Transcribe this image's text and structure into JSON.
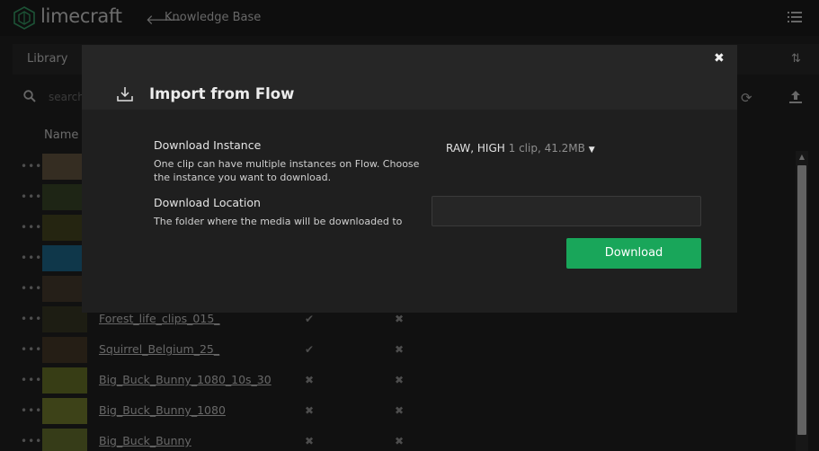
{
  "app": {
    "logo_text": "limecraft",
    "nav_label": "Knowledge Base"
  },
  "library": {
    "title": "Library",
    "search_placeholder": "search",
    "name_column": "Name"
  },
  "rows": [
    {
      "title": "",
      "c1": "",
      "c2": "",
      "thumb": "#6a5a44"
    },
    {
      "title": "",
      "c1": "",
      "c2": "",
      "thumb": "#3d4a2a"
    },
    {
      "title": "",
      "c1": "",
      "c2": "",
      "thumb": "#4a4a22"
    },
    {
      "title": "",
      "c1": "",
      "c2": "",
      "thumb": "#1f6e94"
    },
    {
      "title": "",
      "c1": "",
      "c2": "",
      "thumb": "#4b3e30"
    },
    {
      "title": "Forest_life_clips_015_",
      "c1": "✔",
      "c2": "✖",
      "thumb": "#3a3a26"
    },
    {
      "title": "Squirrel_Belgium_25_",
      "c1": "✔",
      "c2": "✖",
      "thumb": "#4a3c2a"
    },
    {
      "title": "Big_Buck_Bunny_1080_10s_30",
      "c1": "✖",
      "c2": "✖",
      "thumb": "#6f7a2a"
    },
    {
      "title": "Big_Buck_Bunny_1080",
      "c1": "✖",
      "c2": "✖",
      "thumb": "#7a8530"
    },
    {
      "title": "Big_Buck_Bunny",
      "c1": "✖",
      "c2": "✖",
      "thumb": "#6c7830"
    }
  ],
  "modal": {
    "title": "Import from Flow",
    "close": "✖",
    "instance_label": "Download Instance",
    "instance_hint": "One clip can have multiple instances on Flow. Choose the instance you want to download.",
    "instance_value": "RAW, HIGH",
    "instance_meta": "1 clip, 41.2MB",
    "location_label": "Download Location",
    "location_hint": "The folder where the media will be downloaded to",
    "location_value": "",
    "download_button": "Download"
  },
  "colors": {
    "accent": "#19a65a",
    "logo": "#3aa76d"
  }
}
